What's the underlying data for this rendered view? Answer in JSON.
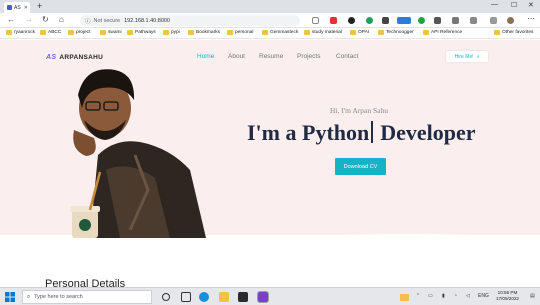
{
  "browser": {
    "tab_title": "AS",
    "new_tab": "+",
    "window_controls": [
      "—",
      "☐",
      "✕"
    ],
    "security_label": "Not secure",
    "url": "192.168.1.40:8000",
    "nav_icons": [
      "back-icon",
      "forward-icon",
      "reload-icon",
      "home-icon"
    ],
    "bookmarks": [
      "ryaanrock",
      "ABCC",
      "project",
      "swami",
      "Pathways",
      "pypi",
      "Bookmarks",
      "personal",
      "Gemmasteck",
      "study material",
      "OPAI",
      "Technoogger",
      "API Reference",
      "Other favorites"
    ]
  },
  "site": {
    "logo": "ARPANSAHU",
    "logo_mark": "AS",
    "nav": [
      "Home",
      "About",
      "Resume",
      "Projects",
      "Contact"
    ],
    "active_nav": "Home",
    "hire_button": "Hire Me!",
    "hire_arrow": "»",
    "greeting": "Hi, I'm Arpan Sahu",
    "headline_prefix": "I'm a",
    "headline_highlight": "Python",
    "headline_suffix": "Developer",
    "cta": "Download CV",
    "section_title": "Personal Details"
  },
  "taskbar": {
    "search_placeholder": "Type here to search",
    "time": "10:56 PM",
    "date": "17/05/2022",
    "lang": "ENG"
  },
  "colors": {
    "accent": "#16b3c7",
    "hero_bg": "#fbeeee",
    "headline": "#1f2a44",
    "highlight": "#f7c948"
  }
}
